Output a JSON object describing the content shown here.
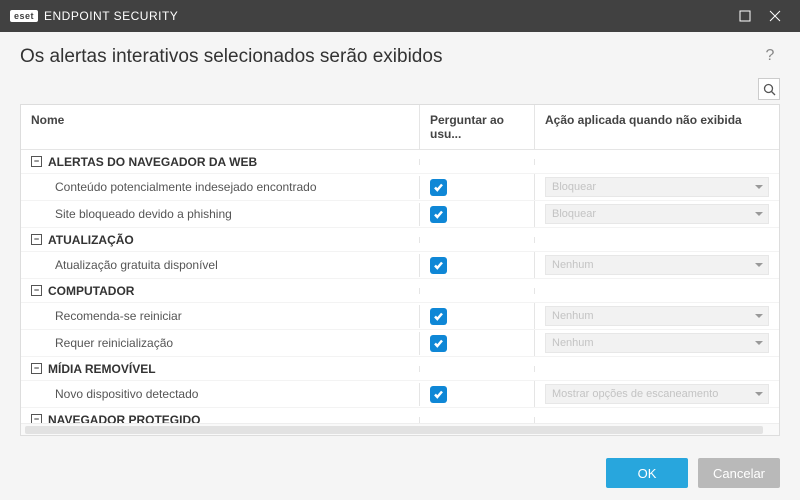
{
  "window": {
    "brand_short": "eset",
    "brand_product": "ENDPOINT SECURITY"
  },
  "header": {
    "title": "Os alertas interativos selecionados serão exibidos",
    "help": "?"
  },
  "columns": {
    "name": "Nome",
    "ask": "Perguntar ao usu...",
    "action": "Ação aplicada quando não exibida"
  },
  "groups": [
    {
      "label": "ALERTAS DO NAVEGADOR DA WEB",
      "items": [
        {
          "name": "Conteúdo potencialmente indesejado encontrado",
          "ask": true,
          "action": "Bloquear"
        },
        {
          "name": "Site bloqueado devido a phishing",
          "ask": true,
          "action": "Bloquear"
        }
      ]
    },
    {
      "label": "ATUALIZAÇÃO",
      "items": [
        {
          "name": "Atualização gratuita disponível",
          "ask": true,
          "action": "Nenhum"
        }
      ]
    },
    {
      "label": "COMPUTADOR",
      "items": [
        {
          "name": "Recomenda-se reiniciar",
          "ask": true,
          "action": "Nenhum"
        },
        {
          "name": "Requer reinicialização",
          "ask": true,
          "action": "Nenhum"
        }
      ]
    },
    {
      "label": "MÍDIA REMOVÍVEL",
      "items": [
        {
          "name": "Novo dispositivo detectado",
          "ask": true,
          "action": "Mostrar opções de escaneamento"
        }
      ]
    },
    {
      "label": "NAVEGADOR PROTEGIDO",
      "items": []
    }
  ],
  "buttons": {
    "ok": "OK",
    "cancel": "Cancelar"
  },
  "collapse_glyph": "−"
}
